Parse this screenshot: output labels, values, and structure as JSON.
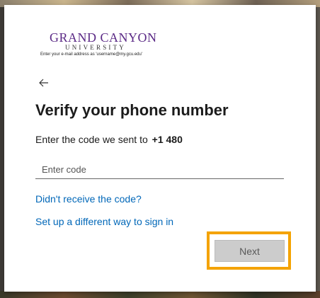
{
  "brand": {
    "line1": "GRAND CANYON",
    "line2": "UNIVERSITY",
    "line3": "Enter your e-mail address as 'username@my.gcu.edu'"
  },
  "nav": {
    "back_icon": "arrow-left-icon"
  },
  "main": {
    "title": "Verify your phone number",
    "description": "Enter the code we sent to",
    "phone": "+1 480",
    "code_input": {
      "value": "",
      "placeholder": "Enter code"
    },
    "links": {
      "resend": "Didn't receive the code?",
      "alternate": "Set up a different way to sign in"
    },
    "next_label": "Next"
  },
  "colors": {
    "brand_purple": "#5b2a86",
    "link_blue": "#0067b8",
    "highlight_orange": "#f4a300",
    "button_disabled": "#cccccc"
  }
}
